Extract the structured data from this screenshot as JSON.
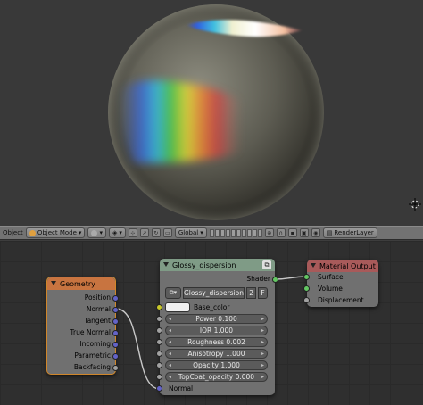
{
  "header": {
    "view_label": "Object",
    "mode_label": "Object Mode",
    "orientation_label": "Global",
    "render_layer_label": "RenderLayer"
  },
  "nodes": {
    "geometry": {
      "title": "Geometry",
      "outputs": [
        "Position",
        "Normal",
        "Tangent",
        "True Normal",
        "Incoming",
        "Parametric",
        "Backfacing"
      ]
    },
    "glossy": {
      "title": "Glossy_dispersion",
      "output_label": "Shader",
      "group_name": "Glossy_dispersion",
      "user_count": "2",
      "fake_user": "F",
      "base_color_label": "Base_color",
      "sliders": [
        {
          "label": "Power",
          "value": "0.100"
        },
        {
          "label": "IOR",
          "value": "1.000"
        },
        {
          "label": "Roughness",
          "value": "0.002"
        },
        {
          "label": "Anisotropy",
          "value": "1.000"
        },
        {
          "label": "Opacity",
          "value": "1.000"
        },
        {
          "label": "TopCoat_opacity",
          "value": "0.000"
        }
      ],
      "normal_label": "Normal"
    },
    "material_output": {
      "title": "Material Output",
      "inputs": [
        "Surface",
        "Volume",
        "Displacement"
      ]
    }
  },
  "colors": {
    "geometry_header": "#c87440",
    "glossy_header": "#7f9b86",
    "output_header": "#a85a5a",
    "socket_vector": "#6363c7",
    "socket_shader": "#63c763",
    "socket_color": "#c7c729"
  }
}
